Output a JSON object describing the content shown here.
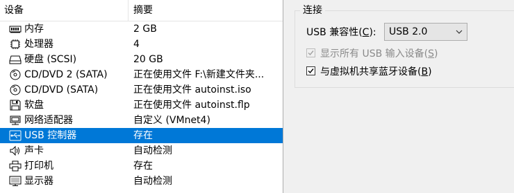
{
  "device_list": {
    "headers": {
      "device": "设备",
      "summary": "摘要"
    },
    "rows": [
      {
        "name": "内存",
        "summary": "2 GB",
        "icon": "memory-icon"
      },
      {
        "name": "处理器",
        "summary": "4",
        "icon": "processor-icon"
      },
      {
        "name": "硬盘 (SCSI)",
        "summary": "20 GB",
        "icon": "hard-disk-icon"
      },
      {
        "name": "CD/DVD 2 (SATA)",
        "summary": "正在使用文件 F:\\新建文件夹...",
        "icon": "cd-dvd-icon"
      },
      {
        "name": "CD/DVD (SATA)",
        "summary": "正在使用文件 autoinst.iso",
        "icon": "cd-dvd-icon"
      },
      {
        "name": "软盘",
        "summary": "正在使用文件 autoinst.flp",
        "icon": "floppy-icon"
      },
      {
        "name": "网络适配器",
        "summary": "自定义 (VMnet4)",
        "icon": "network-adapter-icon"
      },
      {
        "name": "USB 控制器",
        "summary": "存在",
        "icon": "usb-icon",
        "selected": true
      },
      {
        "name": "声卡",
        "summary": "自动检测",
        "icon": "sound-card-icon"
      },
      {
        "name": "打印机",
        "summary": "存在",
        "icon": "printer-icon"
      },
      {
        "name": "显示器",
        "summary": "自动检测",
        "icon": "display-icon"
      }
    ]
  },
  "connection": {
    "title": "连接",
    "usb_compat_label": "USB 兼容性(",
    "usb_compat_key": "C",
    "usb_compat_label_end": "):",
    "usb_compat_value": "USB 2.0",
    "show_all_label": "显示所有 USB 输入设备(",
    "show_all_key": "S",
    "show_all_end": ")",
    "show_all_checked": true,
    "show_all_enabled": false,
    "share_bt_label": "与虚拟机共享蓝牙设备(",
    "share_bt_key": "B",
    "share_bt_end": ")",
    "share_bt_checked": true
  },
  "colors": {
    "selection": "#0078d7"
  }
}
